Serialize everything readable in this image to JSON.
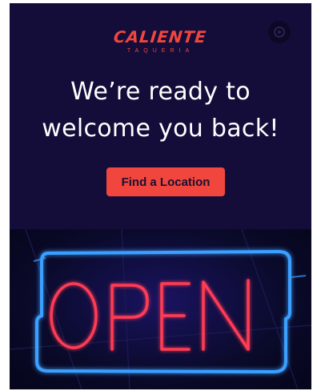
{
  "brand": {
    "name": "CALIENTE",
    "subtitle": "TAQUERIA",
    "color": "#f0463e"
  },
  "header": {
    "corner_icon": "circle-menu-icon"
  },
  "hero": {
    "line1": "We’re ready to",
    "line2": "welcome you back!"
  },
  "cta": {
    "label": "Find a Location",
    "color": "#f0463e"
  },
  "image": {
    "sign_text": "OPEN",
    "frame_color": "#3aa0ff",
    "letter_color": "#ff3a55"
  },
  "colors": {
    "background": "#140d3a"
  }
}
